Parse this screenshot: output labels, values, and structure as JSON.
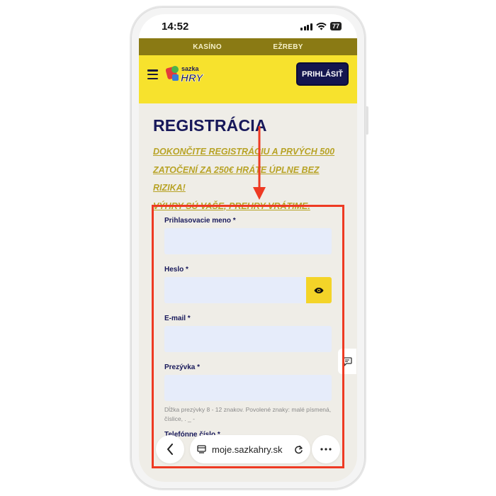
{
  "status": {
    "time": "14:52",
    "battery": "77"
  },
  "topnav": {
    "items": [
      "KASÍNO",
      "EŽREBY"
    ]
  },
  "header": {
    "logo_text_top": "sazka",
    "logo_text_bottom": "HRY",
    "login_label": "PRIHLÁSIŤ"
  },
  "page": {
    "title": "REGISTRÁCIA",
    "promo": [
      "DOKONČITE REGISTRÁCIU A PRVÝCH 500",
      "ZATOČENÍ ZA 250€ HRÁTE ÚPLNE BEZ RIZIKA!",
      "VÝHRY SÚ VAŠE, PREHRY VRÁTIME."
    ]
  },
  "form": {
    "username_label": "Prihlasovacie meno *",
    "password_label": "Heslo *",
    "email_label": "E-mail *",
    "nickname_label": "Prezývka *",
    "nickname_hint": "Dĺžka prezývky 8 - 12 znakov. Povolené znaky: malé písmená, číslice, . _ -",
    "phone_label": "Telefónne číslo *"
  },
  "browser": {
    "url": "moje.sazkahry.sk"
  },
  "colors": {
    "accent_yellow": "#f7e22d",
    "navy": "#14164f",
    "annotation_red": "#ee3a23"
  }
}
